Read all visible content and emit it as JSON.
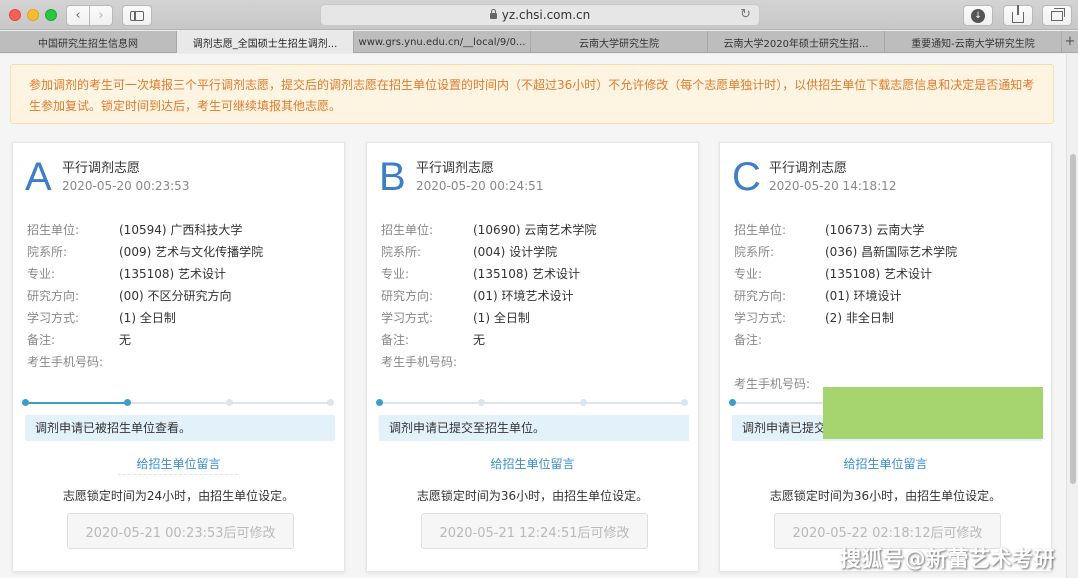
{
  "browser": {
    "url": "yz.chsi.com.cn",
    "tabs": [
      {
        "label": "中国研究生招生信息网",
        "active": false
      },
      {
        "label": "调剂志愿_全国硕士生招生调剂...",
        "active": true
      },
      {
        "label": "www.grs.ynu.edu.cn/__local/9/0...",
        "active": false
      },
      {
        "label": "云南大学研究生院",
        "active": false
      },
      {
        "label": "云南大学2020年硕士研究生招...",
        "active": false
      },
      {
        "label": "重要通知-云南大学研究生院",
        "active": false
      }
    ],
    "new_tab": "+"
  },
  "notice": {
    "text": "参加调剂的考生可一次填报三个平行调剂志愿，提交后的调剂志愿在招生单位设置的时间内（不超过36小时）不允许修改（每个志愿单独计时），以供招生单位下载志愿信息和决定是否通知考生参加复试。锁定时间到达后，考生可继续填报其他志愿。"
  },
  "labels": {
    "unit": "招生单位:",
    "dept": "院系所:",
    "major": "专业:",
    "direction": "研究方向:",
    "mode": "学习方式:",
    "note": "备注:",
    "phone": "考生手机号码:"
  },
  "cards": [
    {
      "letter": "A",
      "title": "平行调剂志愿",
      "time": "2020-05-20 00:23:53",
      "unit": "(10594) 广西科技大学",
      "dept": "(009) 艺术与文化传播学院",
      "major": "(135108) 艺术设计",
      "direction": "(00) 不区分研究方向",
      "mode": "(1) 全日制",
      "note": "无",
      "phone": "",
      "progress": 0.33,
      "status": "调剂申请已被招生单位查看。",
      "message_link": "给招生单位留言",
      "lock_note": "志愿锁定时间为24小时，由招生单位设定。",
      "modify_button": "2020-05-21 00:23:53后可修改"
    },
    {
      "letter": "B",
      "title": "平行调剂志愿",
      "time": "2020-05-20 00:24:51",
      "unit": "(10690) 云南艺术学院",
      "dept": "(004) 设计学院",
      "major": "(135108) 艺术设计",
      "direction": "(01) 环境艺术设计",
      "mode": "(1) 全日制",
      "note": "无",
      "phone": "",
      "progress": 0,
      "status": "调剂申请已提交至招生单位。",
      "message_link": "给招生单位留言",
      "lock_note": "志愿锁定时间为36小时，由招生单位设定。",
      "modify_button": "2020-05-21 12:24:51后可修改"
    },
    {
      "letter": "C",
      "title": "平行调剂志愿",
      "time": "2020-05-20 14:18:12",
      "unit": "(10673) 云南大学",
      "dept": "(036) 昌新国际艺术学院",
      "major": "(135108) 艺术设计",
      "direction": "(01) 环境设计",
      "mode": "(2) 非全日制",
      "note": "",
      "phone": "",
      "progress": 0,
      "status": "调剂申请已提交至招生单位。",
      "message_link": "给招生单位留言",
      "lock_note": "志愿锁定时间为36小时，由招生单位设定。",
      "modify_button": "2020-05-22 02:18:12后可修改"
    }
  ],
  "watermark": "搜狐号@新蕾艺术考研",
  "colors": {
    "accent": "#3d7ec7",
    "notice_text": "#e07a2c",
    "progress": "#3a9ec9",
    "link": "#3a8ed6"
  }
}
